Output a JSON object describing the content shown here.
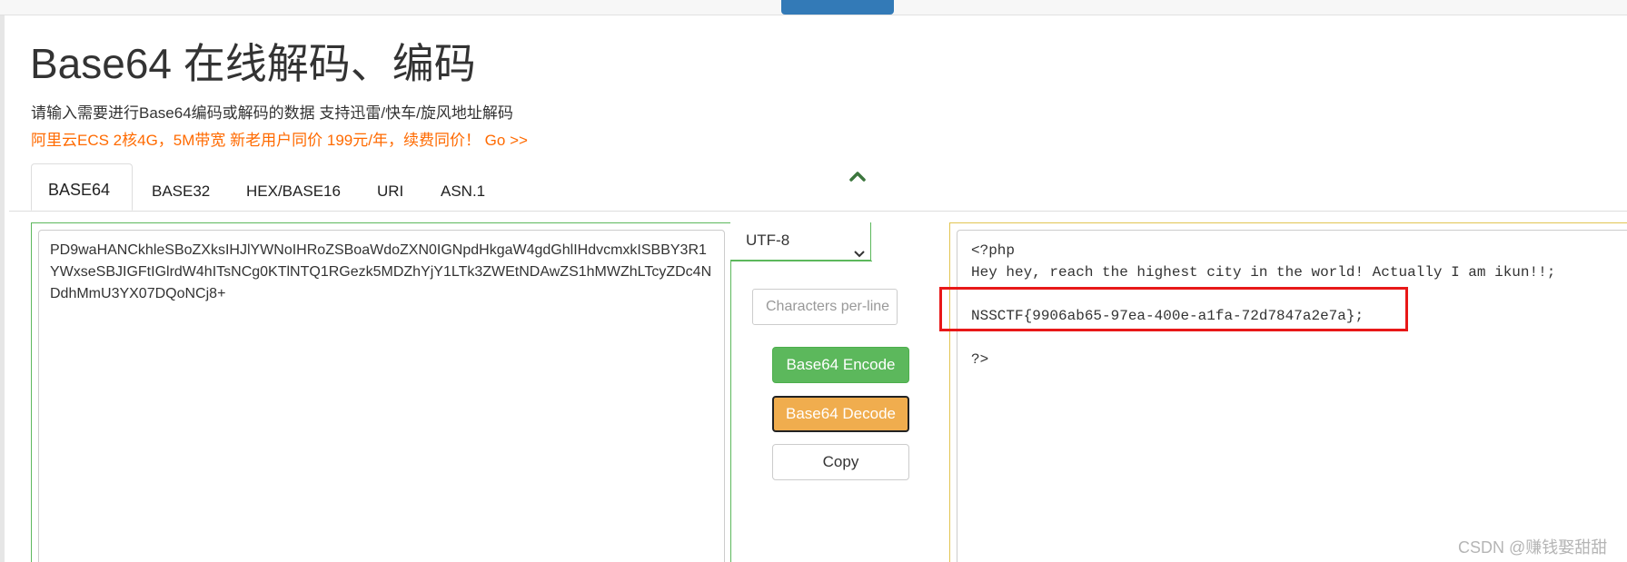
{
  "nav": {
    "active_item_color": "#337ab7"
  },
  "header": {
    "title": "Base64 在线解码、编码",
    "description": "请输入需要进行Base64编码或解码的数据 支持迅雷/快车/旋风地址解码",
    "promo": "阿里云ECS 2核4G，5M带宽 新老用户同价 199元/年，续费同价！ Go >>"
  },
  "tabs": [
    {
      "label": "BASE64",
      "active": true
    },
    {
      "label": "BASE32",
      "active": false
    },
    {
      "label": "HEX/BASE16",
      "active": false
    },
    {
      "label": "URI",
      "active": false
    },
    {
      "label": "ASN.1",
      "active": false
    }
  ],
  "input": {
    "value": "PD9waHANCkhleSBoZXksIHJlYWNoIHRoZSBoaWdoZXN0IGNpdHkgaW4gdGhlIHdvcmxkISBBY3R1YWxseSBJIGFtIGlrdW4hITsNCg0KTlNTQ1RGezk5MDZhYjY1LTk3ZWEtNDAwZS1hMWZhLTcyZDc4NDdhMmU3YX07DQoNCj8+"
  },
  "controls": {
    "encoding": "UTF-8",
    "chars_per_line_placeholder": "Characters per-line",
    "encode_label": "Base64 Encode",
    "decode_label": "Base64 Decode",
    "copy_label": "Copy"
  },
  "output": {
    "line1": "<?php",
    "line2": "Hey hey, reach the highest city in the world! Actually I am ikun!!;",
    "line3": "",
    "line4": "NSSCTF{9906ab65-97ea-400e-a1fa-72d7847a2e7a};",
    "line5": "",
    "line6": "?>"
  },
  "watermark": "CSDN @赚钱娶甜甜",
  "colors": {
    "accent_green": "#5cb85c",
    "accent_orange": "#f0ad4e",
    "promo_orange": "#ff6a00",
    "highlight_red": "#e81818",
    "output_border": "#e2c552"
  }
}
